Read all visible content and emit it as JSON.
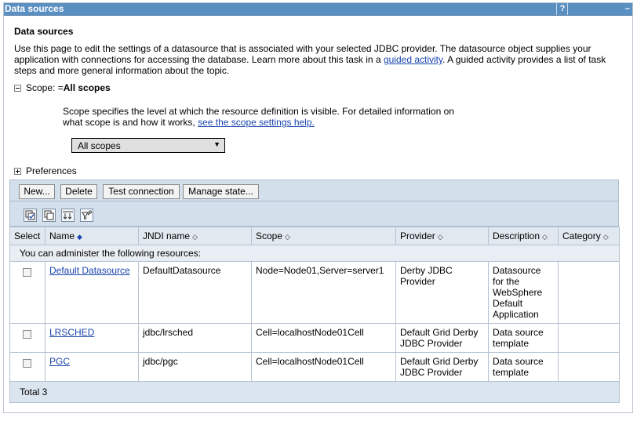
{
  "window": {
    "title": "Data sources",
    "help_label": "?",
    "min_label": "–"
  },
  "page": {
    "heading": "Data sources",
    "desc_before": "Use this page to edit the settings of a datasource that is associated with your selected JDBC provider. The datasource object supplies your application with connections for accessing the database. Learn more about this task in a ",
    "desc_link": "guided activity",
    "desc_after": ". A guided activity provides a list of task steps and more general information about the topic."
  },
  "scope": {
    "label_prefix": "Scope: =",
    "label_value": "All scopes",
    "help_before": "Scope specifies the level at which the resource definition is visible. For detailed information on what scope is and how it works, ",
    "help_link": "see the scope settings help.",
    "selected": "All scopes"
  },
  "preferences": {
    "label": "Preferences"
  },
  "toolbar": {
    "new": "New...",
    "delete": "Delete",
    "test": "Test connection",
    "manage": "Manage state..."
  },
  "table": {
    "headers": {
      "select": "Select",
      "name": "Name",
      "jndi": "JNDI name",
      "scope": "Scope",
      "provider": "Provider",
      "description": "Description",
      "category": "Category"
    },
    "info": "You can administer the following resources:",
    "rows": [
      {
        "name": "Default Datasource",
        "jndi": "DefaultDatasource",
        "scope": "Node=Node01,Server=server1",
        "provider": "Derby JDBC Provider",
        "description": "Datasource for the WebSphere Default Application",
        "category": ""
      },
      {
        "name": "LRSCHED",
        "jndi": "jdbc/lrsched",
        "scope": "Cell=localhostNode01Cell",
        "provider": "Default Grid Derby JDBC Provider",
        "description": "Data source template",
        "category": ""
      },
      {
        "name": "PGC",
        "jndi": "jdbc/pgc",
        "scope": "Cell=localhostNode01Cell",
        "provider": "Default Grid Derby JDBC Provider",
        "description": "Data source template",
        "category": ""
      }
    ],
    "total": "Total 3"
  },
  "icons": {
    "select_all": "select-all-icon",
    "deselect_all": "deselect-all-icon",
    "show_filter": "show-filter-icon",
    "clear_filter": "clear-filter-icon"
  },
  "colors": {
    "title_bar": "#5a8fc1",
    "link": "#1a45ad",
    "toolbar": "#d3dfea"
  }
}
